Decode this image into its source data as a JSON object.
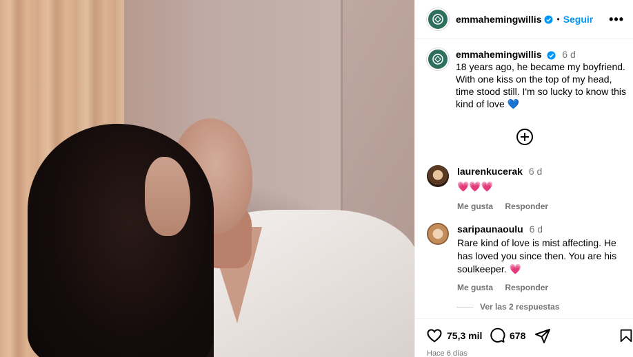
{
  "post": {
    "username": "emmahemingwillis",
    "follow_label": "Seguir",
    "dot": "•",
    "more": "•••",
    "caption_time": "6 d",
    "caption_text": "18 years ago, he became my boyfriend. With one kiss on the top of my head, time stood still. I'm so lucky to know this kind of love 💙"
  },
  "comments": [
    {
      "user": "laurenkucerak",
      "time": "6 d",
      "text": "💗💗💗",
      "like_label": "Me gusta",
      "reply_label": "Responder"
    },
    {
      "user": "saripaunaoulu",
      "time": "6 d",
      "text": "Rare kind of love is mist affecting. He has loved you since then. You are his soulkeeper. 💗",
      "like_label": "Me gusta",
      "reply_label": "Responder"
    }
  ],
  "replies_label": "Ver las 2 respuestas",
  "actions": {
    "likes": "75,3 mil",
    "comments": "678"
  },
  "posted_ago": "Hace 6 días",
  "icons": [
    "heart-icon",
    "comment-icon",
    "share-icon",
    "bookmark-icon",
    "verified-icon",
    "add-comment-icon"
  ],
  "colors": {
    "accent": "#0095f6",
    "verified": "#0095f6",
    "heart": "#ec2d6b",
    "muted": "#737373"
  }
}
